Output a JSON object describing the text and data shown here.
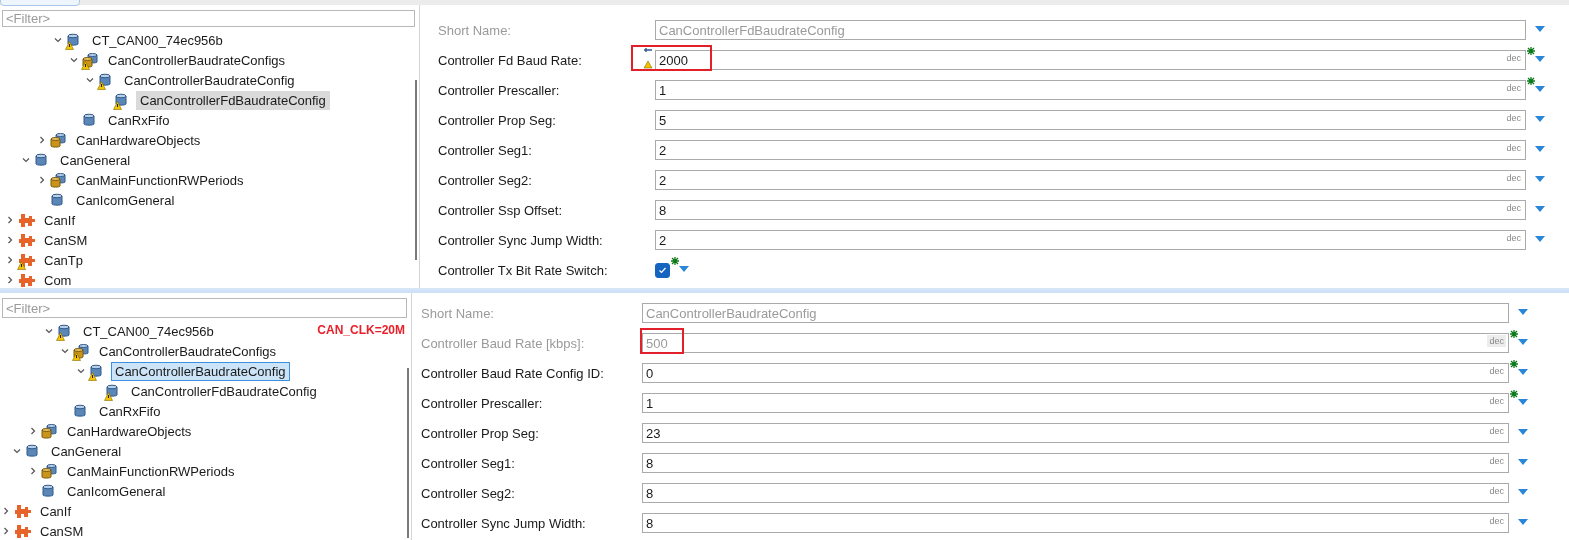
{
  "panels": [
    {
      "focused": false,
      "filter": {
        "placeholder": "<Filter>"
      },
      "tree": [
        {
          "label": "CT_CAN00_74ec956b",
          "kind": "single",
          "warning": true,
          "expanded": true,
          "selected": false,
          "children": [
            {
              "label": "CanControllerBaudrateConfigs",
              "kind": "container",
              "warning": true,
              "expanded": true,
              "selected": false,
              "children": [
                {
                  "label": "CanControllerBaudrateConfig",
                  "kind": "single",
                  "warning": true,
                  "expanded": true,
                  "selected": false,
                  "children": [
                    {
                      "label": "CanControllerFdBaudrateConfig",
                      "kind": "single",
                      "warning": true,
                      "selected": true
                    }
                  ]
                }
              ]
            },
            {
              "label": "CanRxFifo",
              "kind": "single",
              "warning": false,
              "selected": false
            }
          ]
        },
        {
          "label": "CanHardwareObjects",
          "kind": "container",
          "warning": false,
          "expanded": false,
          "selected": false
        },
        {
          "label": "CanGeneral",
          "kind": "single",
          "warning": false,
          "expanded": true,
          "selected": false,
          "children": [
            {
              "label": "CanMainFunctionRWPeriods",
              "kind": "container",
              "warning": false,
              "expanded": false,
              "selected": false
            },
            {
              "label": "CanIcomGeneral",
              "kind": "single",
              "warning": false,
              "selected": false
            }
          ]
        },
        {
          "label": "CanIf",
          "kind": "module",
          "warning": false,
          "expanded": false,
          "selected": false
        },
        {
          "label": "CanSM",
          "kind": "module",
          "warning": false,
          "expanded": false,
          "selected": false
        },
        {
          "label": "CanTp",
          "kind": "module",
          "warning": true,
          "expanded": false,
          "selected": false
        },
        {
          "label": "Com",
          "kind": "module",
          "warning": false,
          "expanded": false,
          "selected": false
        }
      ],
      "form": [
        {
          "kind": "text",
          "label": "Short Name:",
          "value": "CanControllerFdBaudrateConfig",
          "disabled": true,
          "modified": false,
          "highlighted": false,
          "warning": false
        },
        {
          "kind": "number",
          "label": "Controller Fd Baud Rate:",
          "value": "2000",
          "unit": "dec",
          "disabled": false,
          "modified": true,
          "highlighted": true,
          "warning": true
        },
        {
          "kind": "number",
          "label": "Controller Prescaller:",
          "value": "1",
          "unit": "dec",
          "disabled": false,
          "modified": true,
          "highlighted": false,
          "warning": false
        },
        {
          "kind": "number",
          "label": "Controller Prop Seg:",
          "value": "5",
          "unit": "dec",
          "disabled": false,
          "modified": false,
          "highlighted": false,
          "warning": false
        },
        {
          "kind": "number",
          "label": "Controller Seg1:",
          "value": "2",
          "unit": "dec",
          "disabled": false,
          "modified": false,
          "highlighted": false,
          "warning": false
        },
        {
          "kind": "number",
          "label": "Controller Seg2:",
          "value": "2",
          "unit": "dec",
          "disabled": false,
          "modified": false,
          "highlighted": false,
          "warning": false
        },
        {
          "kind": "number",
          "label": "Controller Ssp Offset:",
          "value": "8",
          "unit": "dec",
          "disabled": false,
          "modified": false,
          "highlighted": false,
          "warning": false
        },
        {
          "kind": "number",
          "label": "Controller Sync Jump Width:",
          "value": "2",
          "unit": "dec",
          "disabled": false,
          "modified": false,
          "highlighted": false,
          "warning": false
        },
        {
          "kind": "checkbox",
          "label": "Controller Tx Bit Rate Switch:",
          "checked": true,
          "disabled": false,
          "modified": true,
          "highlighted": false,
          "warning": false
        }
      ]
    },
    {
      "focused": true,
      "filter": {
        "placeholder": "<Filter>"
      },
      "note": "CAN_CLK=20M",
      "tree": [
        {
          "label": "CT_CAN00_74ec956b",
          "kind": "single",
          "warning": true,
          "expanded": true,
          "selected": false,
          "children": [
            {
              "label": "CanControllerBaudrateConfigs",
              "kind": "container",
              "warning": true,
              "expanded": true,
              "selected": false,
              "children": [
                {
                  "label": "CanControllerBaudrateConfig",
                  "kind": "single",
                  "warning": true,
                  "expanded": true,
                  "selected": true,
                  "children": [
                    {
                      "label": "CanControllerFdBaudrateConfig",
                      "kind": "single",
                      "warning": true,
                      "selected": false
                    }
                  ]
                }
              ]
            },
            {
              "label": "CanRxFifo",
              "kind": "single",
              "warning": false,
              "selected": false
            }
          ]
        },
        {
          "label": "CanHardwareObjects",
          "kind": "container",
          "warning": false,
          "expanded": false,
          "selected": false
        },
        {
          "label": "CanGeneral",
          "kind": "single",
          "warning": false,
          "expanded": true,
          "selected": false,
          "children": [
            {
              "label": "CanMainFunctionRWPeriods",
              "kind": "container",
              "warning": false,
              "expanded": false,
              "selected": false
            },
            {
              "label": "CanIcomGeneral",
              "kind": "single",
              "warning": false,
              "selected": false
            }
          ]
        },
        {
          "label": "CanIf",
          "kind": "module",
          "warning": false,
          "expanded": false,
          "selected": false
        },
        {
          "label": "CanSM",
          "kind": "module",
          "warning": false,
          "expanded": false,
          "selected": false
        }
      ],
      "form": [
        {
          "kind": "text",
          "label": "Short Name:",
          "value": "CanControllerBaudrateConfig",
          "disabled": true,
          "modified": false,
          "highlighted": false,
          "warning": false
        },
        {
          "kind": "number",
          "label": "Controller Baud Rate [kbps]:",
          "value": "500",
          "unit": "dec",
          "disabled": true,
          "modified": true,
          "highlighted": true,
          "warning": false
        },
        {
          "kind": "number",
          "label": "Controller Baud Rate Config ID:",
          "value": "0",
          "unit": "dec",
          "disabled": false,
          "modified": true,
          "highlighted": false,
          "warning": false
        },
        {
          "kind": "number",
          "label": "Controller Prescaller:",
          "value": "1",
          "unit": "dec",
          "disabled": false,
          "modified": true,
          "highlighted": false,
          "warning": false
        },
        {
          "kind": "number",
          "label": "Controller Prop Seg:",
          "value": "23",
          "unit": "dec",
          "disabled": false,
          "modified": false,
          "highlighted": false,
          "warning": false
        },
        {
          "kind": "number",
          "label": "Controller Seg1:",
          "value": "8",
          "unit": "dec",
          "disabled": false,
          "modified": false,
          "highlighted": false,
          "warning": false
        },
        {
          "kind": "number",
          "label": "Controller Seg2:",
          "value": "8",
          "unit": "dec",
          "disabled": false,
          "modified": false,
          "highlighted": false,
          "warning": false
        },
        {
          "kind": "number",
          "label": "Controller Sync Jump Width:",
          "value": "8",
          "unit": "dec",
          "disabled": false,
          "modified": false,
          "highlighted": false,
          "warning": false
        }
      ]
    }
  ]
}
